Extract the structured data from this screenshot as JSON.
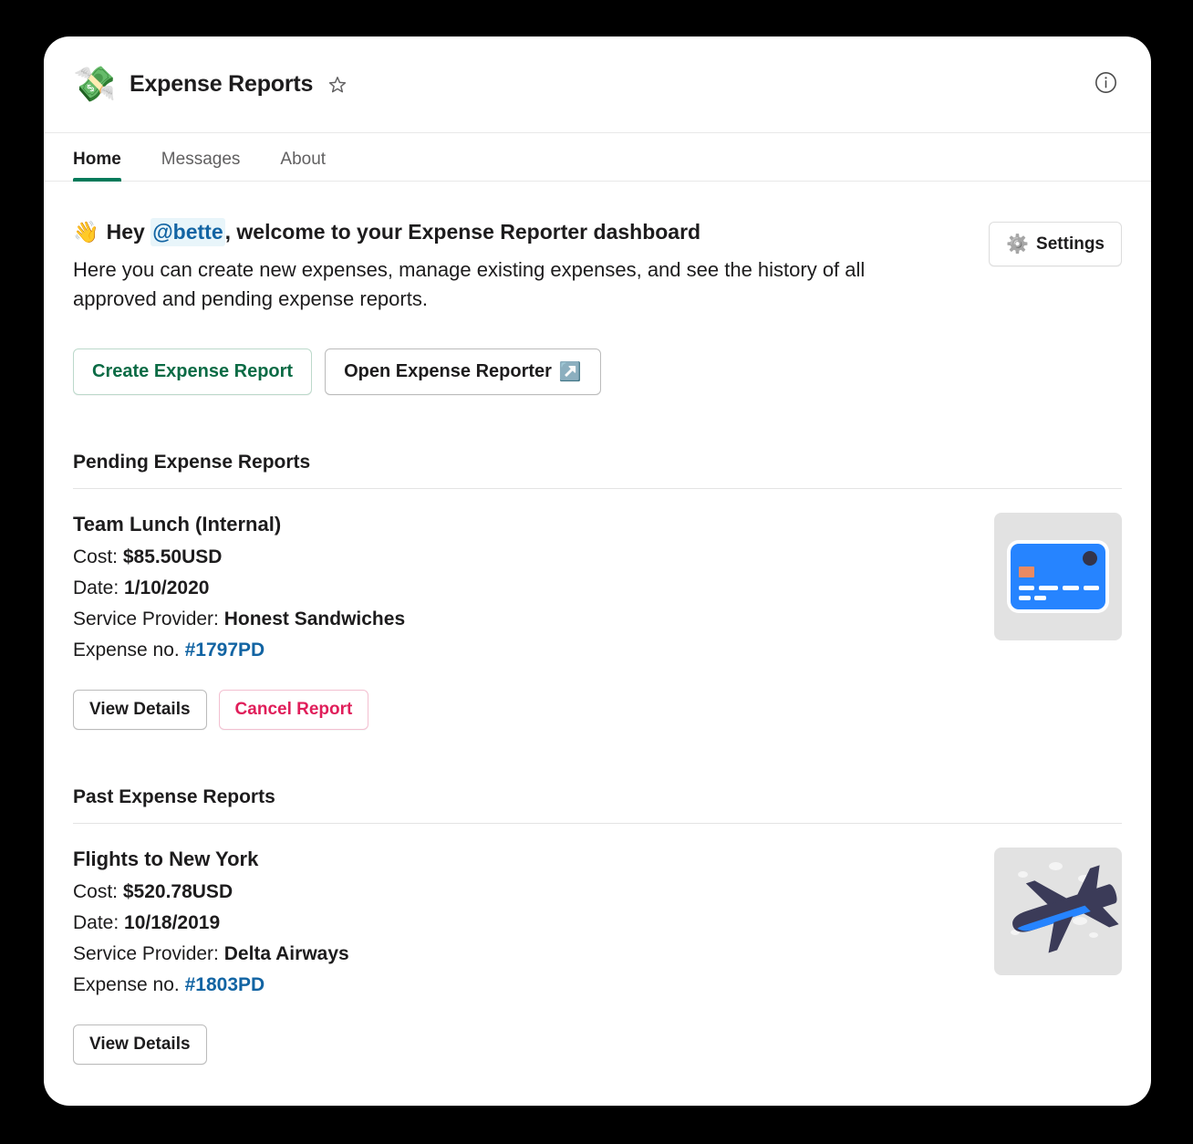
{
  "header": {
    "app_emoji": "money-with-wings-emoji",
    "app_emoji_char": "💸",
    "title": "Expense Reports",
    "star_icon": "star-icon",
    "info_icon": "info-icon"
  },
  "tabs": [
    {
      "label": "Home",
      "active": true
    },
    {
      "label": "Messages",
      "active": false
    },
    {
      "label": "About",
      "active": false
    }
  ],
  "greeting": {
    "wave_emoji": "👋",
    "hey": "Hey",
    "mention": "@bette",
    "rest": ", welcome to your Expense Reporter dashboard",
    "description": "Here you can create new expenses, manage existing expenses, and see the history of all approved and pending expense reports."
  },
  "settings_button": {
    "label": "Settings",
    "gear_emoji": "⚙️"
  },
  "actions": {
    "create_label": "Create Expense Report",
    "open_label": "Open Expense Reporter",
    "open_emoji": "↗️"
  },
  "sections": [
    {
      "title": "Pending Expense Reports",
      "report": {
        "name": "Team Lunch (Internal)",
        "cost_label": "Cost:",
        "cost_value": "$85.50USD",
        "date_label": "Date:",
        "date_value": "1/10/2020",
        "provider_label": "Service Provider:",
        "provider_value": "Honest Sandwiches",
        "expense_label": "Expense no.",
        "expense_value": "#1797PD",
        "thumbnail": "credit-card-image",
        "buttons": [
          {
            "label": "View Details",
            "style": "default"
          },
          {
            "label": "Cancel Report",
            "style": "danger"
          }
        ]
      }
    },
    {
      "title": "Past Expense Reports",
      "report": {
        "name": "Flights to New York",
        "cost_label": "Cost:",
        "cost_value": "$520.78USD",
        "date_label": "Date:",
        "date_value": "10/18/2019",
        "provider_label": "Service Provider:",
        "provider_value": "Delta Airways",
        "expense_label": "Expense no.",
        "expense_value": "#1803PD",
        "thumbnail": "airplane-image",
        "buttons": [
          {
            "label": "View Details",
            "style": "default"
          }
        ]
      }
    }
  ],
  "colors": {
    "accent_green": "#007a5a",
    "link_blue": "#1264a3",
    "danger_pink": "#e01e5a",
    "text": "#1d1c1d",
    "muted": "#616061"
  }
}
